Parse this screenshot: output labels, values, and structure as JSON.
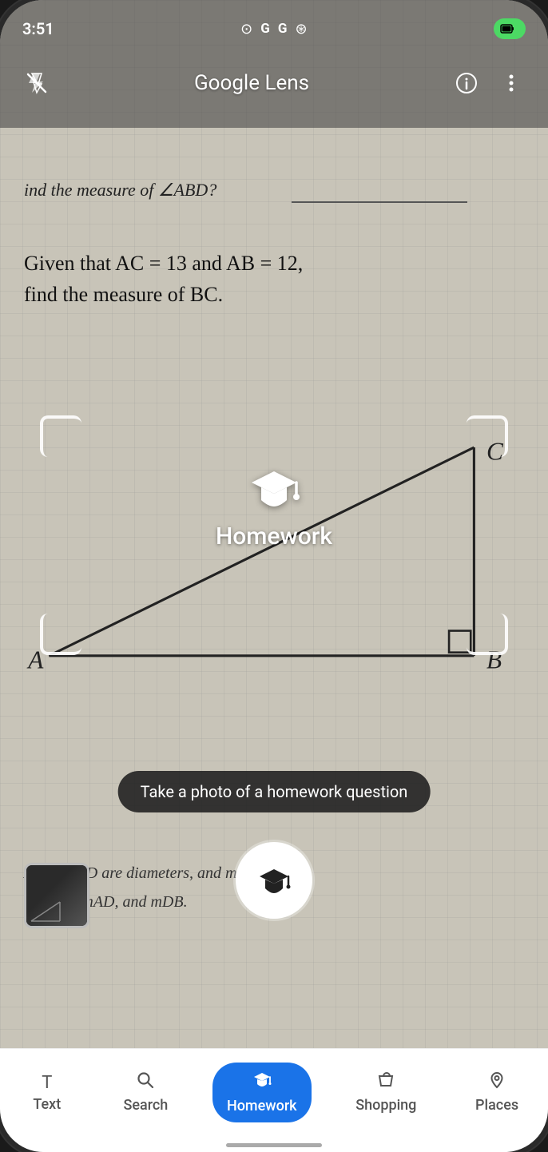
{
  "statusBar": {
    "time": "3:51",
    "icons": [
      "screen-record",
      "google-g",
      "google-g",
      "tennis-ball"
    ],
    "battery": "□"
  },
  "toolbar": {
    "title": "Google Lens",
    "flashLabel": "flash-off",
    "infoLabel": "info",
    "moreLabel": "more-vert"
  },
  "worksheet": {
    "question1": "ind the measure of ∠ABD?",
    "question2line1": "Given that AC = 13 and AB = 12,",
    "question2line2": "find the measure of BC.",
    "bottomText1": "AB and CD are diameters, and m",
    "bottomText2": "nd m∠         , mAD, and mDB."
  },
  "lensOverlay": {
    "mode": "Homework",
    "icon": "graduation-cap"
  },
  "hint": {
    "text": "Take a photo of a homework question"
  },
  "tabs": [
    {
      "id": "text",
      "label": "Text",
      "icon": "text",
      "active": false
    },
    {
      "id": "search",
      "label": "Search",
      "icon": "search",
      "active": false
    },
    {
      "id": "homework",
      "label": "Homework",
      "icon": "graduation-cap",
      "active": true
    },
    {
      "id": "shopping",
      "label": "Shopping",
      "icon": "shopping-bag",
      "active": false
    },
    {
      "id": "places",
      "label": "Places",
      "icon": "location",
      "active": false
    }
  ],
  "colors": {
    "activeTab": "#1a73e8",
    "tabText": "#555555",
    "tabBg": "#ffffff"
  }
}
